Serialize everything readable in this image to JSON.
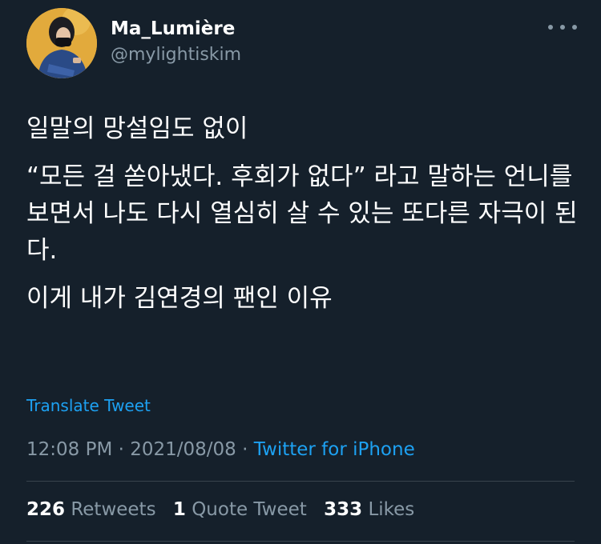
{
  "user": {
    "display_name": "Ma_Lumière",
    "handle": "@mylightiskim"
  },
  "tweet": {
    "paragraphs": [
      "일말의 망설임도 없이",
      "“모든 걸 쏟아냈다. 후회가 없다” 라고 말하는 언니를 보면서 나도 다시 열심히 살 수 있는 또다른 자극이 된다.",
      "이게 내가 김연경의 팬인 이유"
    ],
    "translate_label": "Translate Tweet",
    "time": "12:08 PM",
    "separator": "·",
    "date": "2021/08/08",
    "source": "Twitter for iPhone"
  },
  "stats": {
    "retweets_count": "226",
    "retweets_label": "Retweets",
    "quotes_count": "1",
    "quotes_label": "Quote Tweet",
    "likes_count": "333",
    "likes_label": "Likes"
  },
  "icons": {
    "more": "more-horizontal-icon"
  },
  "colors": {
    "background": "#15202b",
    "text": "#ffffff",
    "secondary_text": "#8899a6",
    "link": "#1da1f2",
    "divider": "#38444d"
  }
}
